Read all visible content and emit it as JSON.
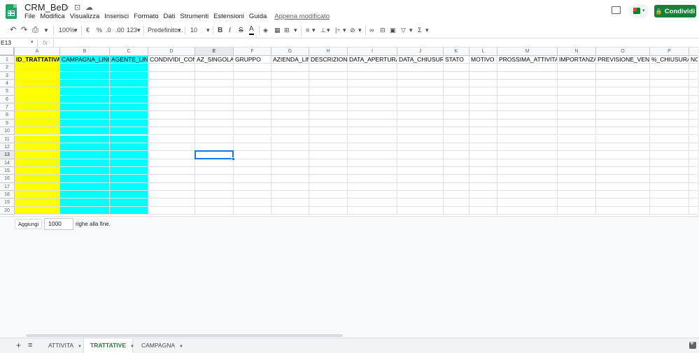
{
  "doc": {
    "title": "CRM_BeD",
    "star_icon": "☆",
    "move_icon": "⊡",
    "cloud_icon": "☁"
  },
  "menu": {
    "items": [
      "File",
      "Modifica",
      "Visualizza",
      "Inserisci",
      "Formato",
      "Dati",
      "Strumenti",
      "Estensioni",
      "Guida"
    ],
    "last_edit": "Appena modificato"
  },
  "share": {
    "label": "Condividi",
    "lock_icon": "🔒"
  },
  "toolbar": {
    "undo": "↶",
    "redo": "↷",
    "print": "⎙",
    "paint_format": "▼",
    "zoom": "100%",
    "currency": "€",
    "percent": "%",
    "decrease_decimals": ".0",
    "increase_decimals": ".00",
    "more_formats": "123",
    "font": "Predefinito...",
    "font_size": "10",
    "bold": "B",
    "italic": "I",
    "strikethrough": "S",
    "text_color": "A",
    "caret": "▾"
  },
  "formula_bar": {
    "cell_ref": "E13",
    "fx": "fx",
    "value": ""
  },
  "grid": {
    "columns": [
      "A",
      "B",
      "C",
      "D",
      "E",
      "F",
      "G",
      "H",
      "I",
      "J",
      "K",
      "L",
      "M",
      "N",
      "O",
      "P",
      ""
    ],
    "rows": [
      "1",
      "2",
      "3",
      "4",
      "5",
      "6",
      "7",
      "8",
      "9",
      "10",
      "11",
      "12",
      "13",
      "14",
      "15",
      "16",
      "17",
      "18",
      "19",
      "20"
    ],
    "header_row": [
      "ID_TRATTATIVA",
      "CAMPAGNA_LINK",
      "AGENTE_LINK",
      "CONDIVIDI_CON",
      "AZ_SINGOLA(",
      "GRUPPO",
      "AZIENDA_LINK",
      "DESCRIZIONE",
      "DATA_APERTURA",
      "DATA_CHIUSURA",
      "STATO",
      "MOTIVO",
      "PROSSIMA_ATTIVITA_IL",
      "IMPORTANZA",
      "PREVISIONE_VENDIT.",
      "%_CHIUSURA",
      "NO"
    ],
    "selected_cell": "E13",
    "colors": {
      "yellow": "#ffff00",
      "cyan": "#00ffff",
      "selection": "#1a73e8"
    }
  },
  "add_rows": {
    "button": "Aggiungi",
    "count": "1000",
    "suffix": "righe alla fine."
  },
  "sheets": {
    "tabs": [
      {
        "name": "ATTIVITA",
        "active": false
      },
      {
        "name": "TRATTATIVE",
        "active": true
      },
      {
        "name": "CAMPAGNA",
        "active": false
      }
    ],
    "add_icon": "+",
    "list_icon": "≡"
  }
}
